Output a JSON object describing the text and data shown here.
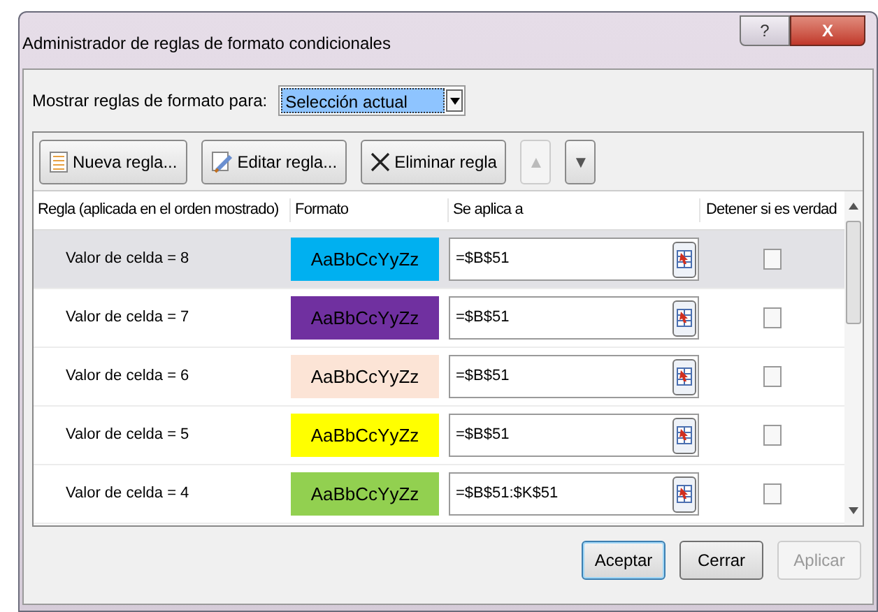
{
  "window": {
    "title": "Administrador de reglas de formato condicionales",
    "help_label": "?",
    "close_label": "X"
  },
  "filter": {
    "label": "Mostrar reglas de formato para:",
    "value": "Selección actual"
  },
  "toolbar": [
    {
      "kind": "new",
      "label": "Nueva regla...",
      "disabled": false
    },
    {
      "kind": "edit",
      "label": "Editar regla...",
      "disabled": false
    },
    {
      "kind": "delete",
      "label": "Eliminar regla",
      "disabled": false
    },
    {
      "kind": "up",
      "label": "▲",
      "disabled": true
    },
    {
      "kind": "down",
      "label": "▼",
      "disabled": false
    }
  ],
  "table": {
    "columns": [
      "Regla (aplicada en el orden mostrado)",
      "Formato",
      "Se aplica a",
      "Detener si es verdad"
    ],
    "rows": [
      {
        "rule": "Valor de celda = 8",
        "preview": "AaBbCcYyZz",
        "color": "#00b0f0",
        "applies_to": "=$B$51",
        "stop": false,
        "selected": true
      },
      {
        "rule": "Valor de celda = 7",
        "preview": "AaBbCcYyZz",
        "color": "#7030a0",
        "applies_to": "=$B$51",
        "stop": false,
        "selected": false
      },
      {
        "rule": "Valor de celda = 6",
        "preview": "AaBbCcYyZz",
        "color": "#fce4d6",
        "applies_to": "=$B$51",
        "stop": false,
        "selected": false
      },
      {
        "rule": "Valor de celda = 5",
        "preview": "AaBbCcYyZz",
        "color": "#ffff00",
        "applies_to": "=$B$51",
        "stop": false,
        "selected": false
      },
      {
        "rule": "Valor de celda = 4",
        "preview": "AaBbCcYyZz",
        "color": "#92d050",
        "applies_to": "=$B$51:$K$51",
        "stop": false,
        "selected": false
      }
    ]
  },
  "buttons": [
    {
      "label": "Aceptar",
      "default": true,
      "disabled": false
    },
    {
      "label": "Cerrar",
      "default": false,
      "disabled": false
    },
    {
      "label": "Aplicar",
      "default": false,
      "disabled": true
    }
  ]
}
